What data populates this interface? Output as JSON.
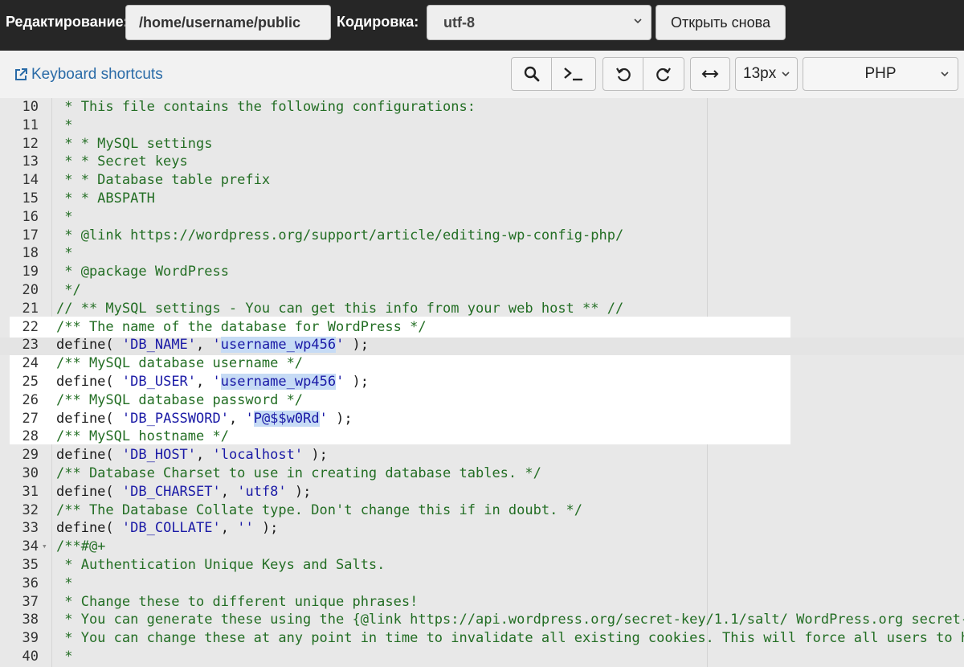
{
  "topbar": {
    "edit_label": "Редактирование:",
    "path_value": "/home/username/public",
    "encoding_label": "Кодировка:",
    "encoding_value": "utf-8",
    "reopen_label": "Открыть снова"
  },
  "toolbar": {
    "keyboard_shortcuts": "Keyboard shortcuts",
    "font_size": "13px",
    "mode": "PHP"
  },
  "editor": {
    "lines": [
      {
        "n": "10",
        "parts": [
          {
            "t": " * This file contains the following configurations:",
            "c": "c-com"
          }
        ]
      },
      {
        "n": "11",
        "parts": [
          {
            "t": " *",
            "c": "c-com"
          }
        ]
      },
      {
        "n": "12",
        "parts": [
          {
            "t": " * * MySQL settings",
            "c": "c-com"
          }
        ]
      },
      {
        "n": "13",
        "parts": [
          {
            "t": " * * Secret keys",
            "c": "c-com"
          }
        ]
      },
      {
        "n": "14",
        "parts": [
          {
            "t": " * * Database table prefix",
            "c": "c-com"
          }
        ]
      },
      {
        "n": "15",
        "parts": [
          {
            "t": " * * ABSPATH",
            "c": "c-com"
          }
        ]
      },
      {
        "n": "16",
        "parts": [
          {
            "t": " *",
            "c": "c-com"
          }
        ]
      },
      {
        "n": "17",
        "parts": [
          {
            "t": " * @link https://wordpress.org/support/article/editing-wp-config-php/",
            "c": "c-com"
          }
        ]
      },
      {
        "n": "18",
        "parts": [
          {
            "t": " *",
            "c": "c-com"
          }
        ]
      },
      {
        "n": "19",
        "parts": [
          {
            "t": " * @package WordPress",
            "c": "c-com"
          }
        ]
      },
      {
        "n": "20",
        "parts": [
          {
            "t": " */",
            "c": "c-com"
          }
        ]
      },
      {
        "n": "21",
        "parts": [
          {
            "t": "// ** MySQL settings - You can get this info from your web host ** //",
            "c": "c-com"
          }
        ]
      },
      {
        "n": "22",
        "parts": [
          {
            "t": "/** The name of the database for WordPress */",
            "c": "c-com"
          }
        ]
      },
      {
        "n": "23",
        "parts": [
          {
            "t": "define",
            "c": "c-fn"
          },
          {
            "t": "( ",
            "c": "c-pun"
          },
          {
            "t": "'DB_NAME'",
            "c": "c-str"
          },
          {
            "t": ", ",
            "c": "c-pun"
          },
          {
            "t": "'",
            "c": "c-str"
          },
          {
            "t": "username_wp456",
            "c": "c-str c-sel"
          },
          {
            "t": "'",
            "c": "c-str"
          },
          {
            "t": " );",
            "c": "c-pun"
          }
        ]
      },
      {
        "n": "24",
        "parts": [
          {
            "t": "/** MySQL database username */",
            "c": "c-com"
          }
        ]
      },
      {
        "n": "25",
        "parts": [
          {
            "t": "define",
            "c": "c-fn"
          },
          {
            "t": "( ",
            "c": "c-pun"
          },
          {
            "t": "'DB_USER'",
            "c": "c-str"
          },
          {
            "t": ", ",
            "c": "c-pun"
          },
          {
            "t": "'",
            "c": "c-str"
          },
          {
            "t": "username_wp456",
            "c": "c-str c-sel"
          },
          {
            "t": "'",
            "c": "c-str"
          },
          {
            "t": " );",
            "c": "c-pun"
          }
        ]
      },
      {
        "n": "26",
        "parts": [
          {
            "t": "/** MySQL database password */",
            "c": "c-com"
          }
        ]
      },
      {
        "n": "27",
        "parts": [
          {
            "t": "define",
            "c": "c-fn"
          },
          {
            "t": "( ",
            "c": "c-pun"
          },
          {
            "t": "'DB_PASSWORD'",
            "c": "c-str"
          },
          {
            "t": ", ",
            "c": "c-pun"
          },
          {
            "t": "'",
            "c": "c-str"
          },
          {
            "t": "P@$$w0Rd",
            "c": "c-str c-sel"
          },
          {
            "t": "'",
            "c": "c-str"
          },
          {
            "t": " );",
            "c": "c-pun"
          }
        ]
      },
      {
        "n": "28",
        "parts": [
          {
            "t": "/** MySQL hostname */",
            "c": "c-com"
          }
        ]
      },
      {
        "n": "29",
        "parts": [
          {
            "t": "define",
            "c": "c-fn"
          },
          {
            "t": "( ",
            "c": "c-pun"
          },
          {
            "t": "'DB_HOST'",
            "c": "c-str"
          },
          {
            "t": ", ",
            "c": "c-pun"
          },
          {
            "t": "'localhost'",
            "c": "c-str"
          },
          {
            "t": " );",
            "c": "c-pun"
          }
        ]
      },
      {
        "n": "30",
        "parts": [
          {
            "t": "/** Database Charset to use in creating database tables. */",
            "c": "c-com"
          }
        ]
      },
      {
        "n": "31",
        "parts": [
          {
            "t": "define",
            "c": "c-fn"
          },
          {
            "t": "( ",
            "c": "c-pun"
          },
          {
            "t": "'DB_CHARSET'",
            "c": "c-str"
          },
          {
            "t": ", ",
            "c": "c-pun"
          },
          {
            "t": "'utf8'",
            "c": "c-str"
          },
          {
            "t": " );",
            "c": "c-pun"
          }
        ]
      },
      {
        "n": "32",
        "parts": [
          {
            "t": "/** The Database Collate type. Don't change this if in doubt. */",
            "c": "c-com"
          }
        ]
      },
      {
        "n": "33",
        "parts": [
          {
            "t": "define",
            "c": "c-fn"
          },
          {
            "t": "( ",
            "c": "c-pun"
          },
          {
            "t": "'DB_COLLATE'",
            "c": "c-str"
          },
          {
            "t": ", ",
            "c": "c-pun"
          },
          {
            "t": "''",
            "c": "c-str"
          },
          {
            "t": " );",
            "c": "c-pun"
          }
        ]
      },
      {
        "n": "34",
        "fold": true,
        "parts": [
          {
            "t": "/**#@+",
            "c": "c-com"
          }
        ]
      },
      {
        "n": "35",
        "parts": [
          {
            "t": " * Authentication Unique Keys and Salts.",
            "c": "c-com"
          }
        ]
      },
      {
        "n": "36",
        "parts": [
          {
            "t": " *",
            "c": "c-com"
          }
        ]
      },
      {
        "n": "37",
        "parts": [
          {
            "t": " * Change these to different unique phrases!",
            "c": "c-com"
          }
        ]
      },
      {
        "n": "38",
        "parts": [
          {
            "t": " * You can generate these using the {@link https://api.wordpress.org/secret-key/1.1/salt/ WordPress.org secret-k",
            "c": "c-com"
          }
        ]
      },
      {
        "n": "39",
        "parts": [
          {
            "t": " * You can change these at any point in time to invalidate all existing cookies. This will force all users to ha",
            "c": "c-com"
          }
        ]
      },
      {
        "n": "40",
        "parts": [
          {
            "t": " *",
            "c": "c-com"
          }
        ]
      }
    ]
  }
}
